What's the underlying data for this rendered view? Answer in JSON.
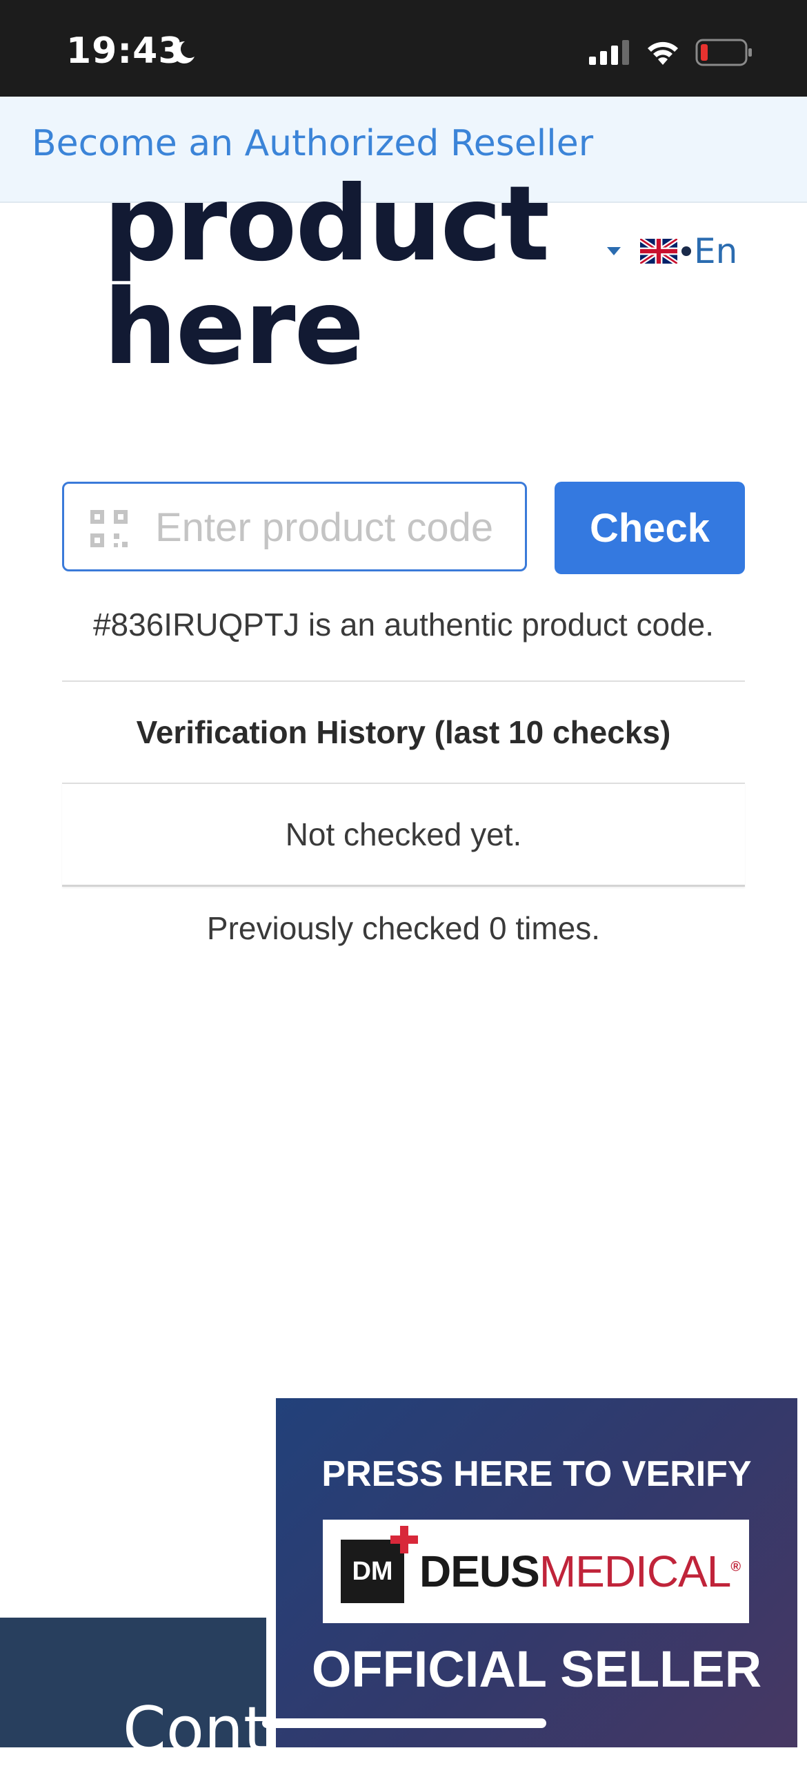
{
  "status_bar": {
    "time": "19:43"
  },
  "banner": {
    "link": "Become an Authorized Reseller"
  },
  "page": {
    "heading": "product here"
  },
  "language": {
    "label": "En"
  },
  "verify_form": {
    "placeholder": "Enter product code",
    "check_label": "Check"
  },
  "result": {
    "message": "#836IRUQPTJ is an authentic product code."
  },
  "history": {
    "title": "Verification History (last 10 checks)",
    "empty": "Not checked yet."
  },
  "count": {
    "text": "Previously checked 0 times."
  },
  "badge": {
    "top": "PRESS HERE TO VERIFY",
    "logo_mark": "DM",
    "brand_part1": "DEUS",
    "brand_part2": "MEDICAL",
    "registered": "®",
    "bottom": "OFFICIAL SELLER"
  },
  "footer": {
    "partial_text": "Cont"
  },
  "colors": {
    "accent": "#3479e0",
    "brand_red": "#c0243a",
    "footer_bg": "#283f5e"
  }
}
